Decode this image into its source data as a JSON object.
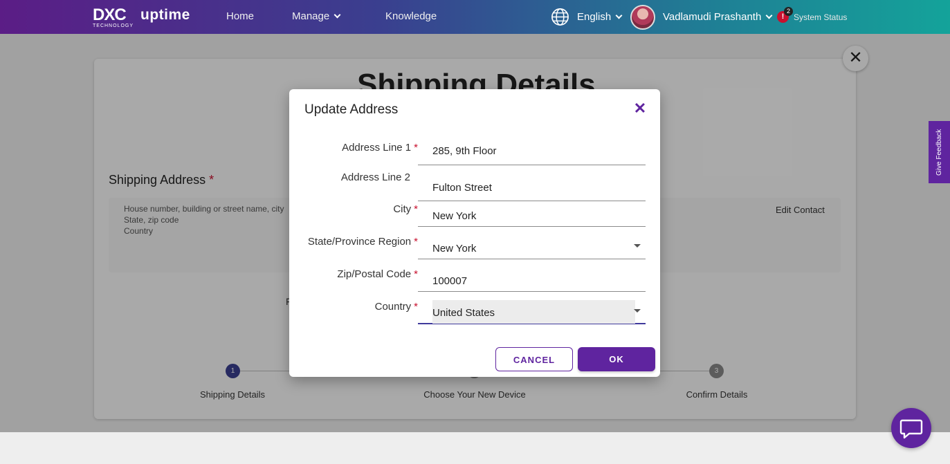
{
  "header": {
    "logo_text": "DXC",
    "logo_sub": "TECHNOLOGY",
    "brand": "uptime",
    "nav": {
      "home": "Home",
      "manage": "Manage",
      "knowledge": "Knowledge"
    },
    "language": "English",
    "user_name": "Vadlamudi Prashanth",
    "status_count": "2",
    "status_label": "System Status"
  },
  "page": {
    "title": "Shipping Details",
    "shipping_address_label": "Shipping Address",
    "address_placeholder": {
      "line1": "House number, building or street name, city",
      "line2": "State, zip code",
      "line3": "Country"
    },
    "edit_contact": "Edit Contact",
    "fragment_left": "F",
    "fragment_right": ".",
    "steps": [
      {
        "number": "1",
        "label": "Shipping Details",
        "color": "#3a3f8f"
      },
      {
        "number": "2",
        "label": "Choose Your New Device",
        "color": "#888888"
      },
      {
        "number": "3",
        "label": "Confirm Details",
        "color": "#888888"
      }
    ]
  },
  "feedback_label": "Give Feedback",
  "dialog": {
    "title": "Update Address",
    "fields": {
      "address1": {
        "label": "Address Line 1",
        "value": "285, 9th Floor",
        "required": "*"
      },
      "address2": {
        "label": "Address Line 2",
        "value": "Fulton Street"
      },
      "city": {
        "label": "City",
        "value": "New York",
        "required": "*"
      },
      "state": {
        "label": "State/Province Region",
        "value": "New York",
        "required": "*"
      },
      "zip": {
        "label": "Zip/Postal Code",
        "value": "100007",
        "required": "*"
      },
      "country": {
        "label": "Country",
        "value": "United States",
        "required": "*"
      }
    },
    "cancel_label": "CANCEL",
    "ok_label": "OK"
  },
  "colors": {
    "accent": "#5f249f",
    "required": "#c8102e",
    "header_start": "#5b1d86",
    "header_end": "#14a39a"
  },
  "icons": [
    "globe-icon",
    "chevron-down-icon",
    "close-icon",
    "caret-down-icon",
    "chat-icon",
    "alert-icon"
  ]
}
